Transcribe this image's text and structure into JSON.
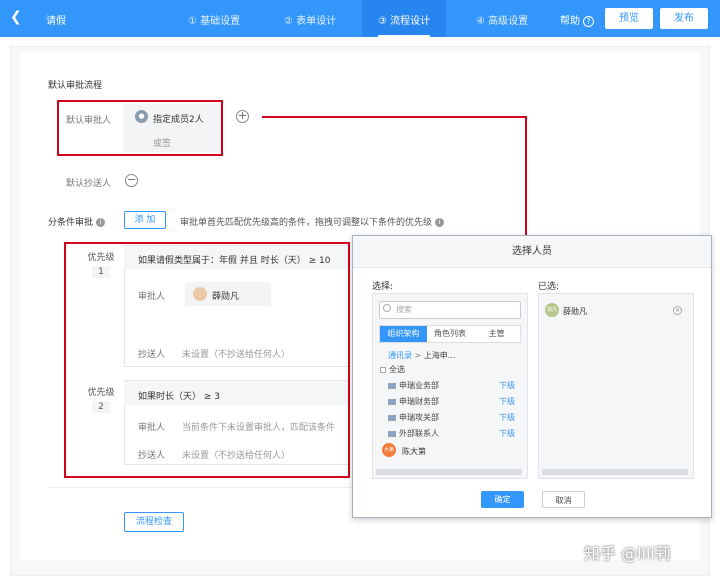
{
  "header": {
    "back_icon": "chevron-left-icon",
    "title": "请假",
    "steps": [
      {
        "label": "① 基础设置"
      },
      {
        "label": "② 表单设计"
      },
      {
        "label": "③ 流程设计"
      },
      {
        "label": "④ 高级设置"
      }
    ],
    "help_label": "帮助",
    "help_icon": "question-icon",
    "preview_label": "预览",
    "publish_label": "发布"
  },
  "default_flow": {
    "section_title": "默认审批流程",
    "approver_label": "默认审批人",
    "approver_value": "指定成员2人",
    "approver_mode": "或签",
    "cc_label": "默认抄送人"
  },
  "conditional": {
    "label": "分条件审批",
    "add_label": "添 加",
    "hint": "审批单首先匹配优先级高的条件，拖拽可调整以下条件的优先级",
    "rules": [
      {
        "priority_label": "优先级",
        "priority_no": "1",
        "condition": "如果请假类型属于：年假 并且 时长（天） ≥ 10",
        "approver_label": "审批人",
        "approver": "薛勋凡",
        "cc_label": "抄送人",
        "cc_value": "未设置（不抄送给任何人）"
      },
      {
        "priority_label": "优先级",
        "priority_no": "2",
        "condition": "如果时长（天） ≥ 3",
        "approver_label": "审批人",
        "approver_text": "当前条件下未设置审批人，匹配该条件",
        "cc_label": "抄送人",
        "cc_value": "未设置（不抄送给任何人）"
      }
    ],
    "check_label": "流程检查"
  },
  "modal": {
    "title": "选择人员",
    "select_label": "选择:",
    "selected_label": "已选:",
    "search_placeholder": "搜索",
    "tabs": [
      "组织架构",
      "角色列表",
      "主管"
    ],
    "breadcrumb_root": "通讯录",
    "breadcrumb_current": "上海申...",
    "select_all": "全选",
    "departments": [
      {
        "name": "申瑞业务部",
        "sub": "下级"
      },
      {
        "name": "申瑞财务部",
        "sub": "下级"
      },
      {
        "name": "申瑞攻关部",
        "sub": "下级"
      },
      {
        "name": "外部联系人",
        "sub": "下级"
      }
    ],
    "person": "陈大第",
    "person_avatar": "大第",
    "selected_person": "薛勋凡",
    "selected_avatar": "勋凡",
    "confirm_label": "确定",
    "cancel_label": "取消"
  },
  "watermark": "知乎 @lili莉"
}
